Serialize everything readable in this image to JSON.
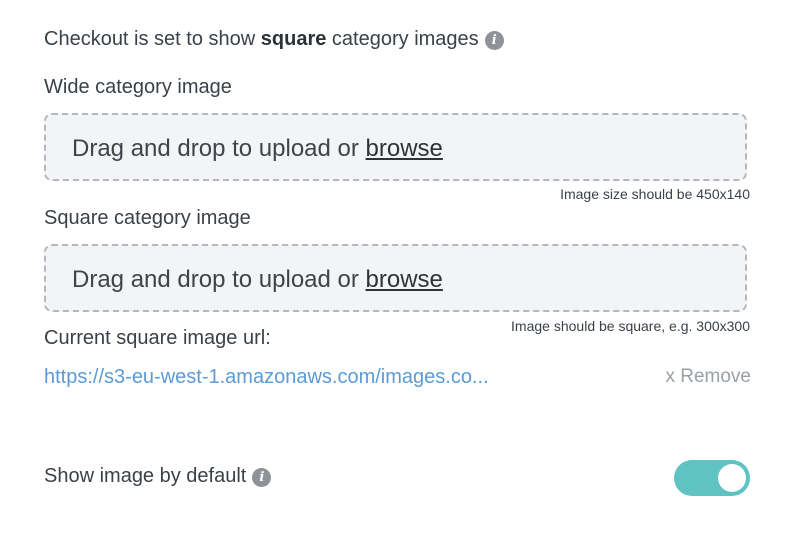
{
  "header": {
    "prefix": "Checkout is set to show ",
    "emphasis": "square",
    "suffix": " category images",
    "info_icon": "i"
  },
  "wide_image": {
    "label": "Wide category image",
    "drop_text": "Drag and drop to upload or ",
    "browse_label": "browse",
    "hint": "Image size should be 450x140"
  },
  "square_image": {
    "label": "Square category image",
    "drop_text": "Drag and drop to upload or ",
    "browse_label": "browse",
    "hint": "Image should be square, e.g. 300x300"
  },
  "current_url": {
    "label": "Current square image url:",
    "url_text": "https://s3-eu-west-1.amazonaws.com/images.co...",
    "remove_label": "x Remove"
  },
  "show_default": {
    "label": "Show image by default",
    "info_icon": "i",
    "toggle_on": true
  },
  "colors": {
    "link": "#5b9bd5",
    "toggle_on": "#5fc3c4",
    "muted": "#9aa0a6"
  }
}
